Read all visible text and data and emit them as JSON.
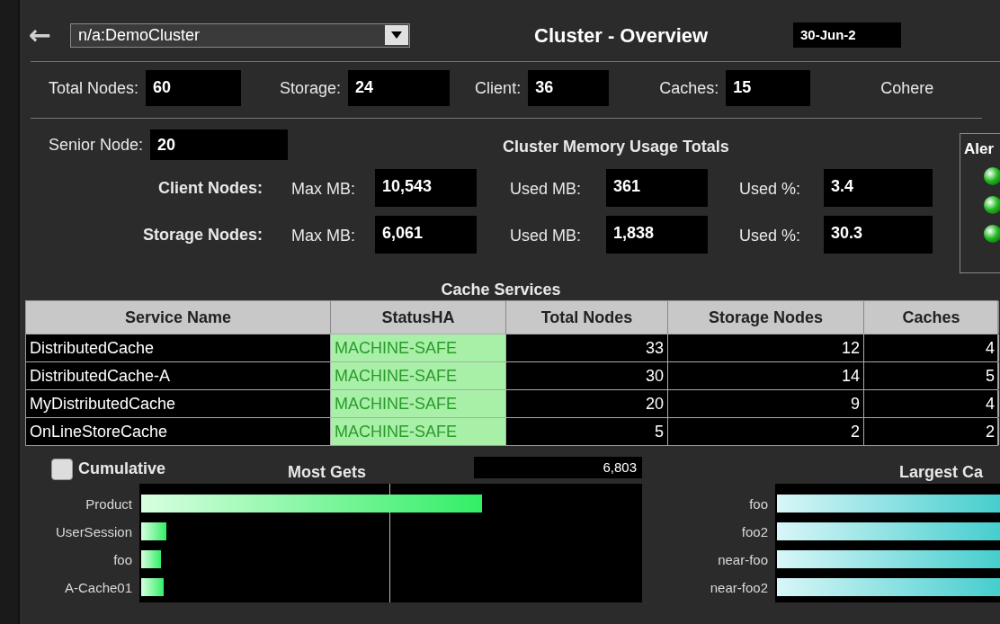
{
  "header": {
    "back": "←",
    "cluster_select": "n/a:DemoCluster",
    "title": "Cluster - Overview",
    "date": "30-Jun-2"
  },
  "counts": [
    {
      "label": "Total Nodes:",
      "value": "60"
    },
    {
      "label": "Storage:",
      "value": "24"
    },
    {
      "label": "Client:",
      "value": "36"
    },
    {
      "label": "Caches:",
      "value": "15"
    },
    {
      "label": "Cohere"
    }
  ],
  "senior_node": {
    "label": "Senior Node:",
    "value": "20"
  },
  "memory": {
    "title": "Cluster Memory Usage Totals",
    "rows": [
      {
        "label": "Client Nodes:",
        "fields": [
          {
            "label": "Max MB:",
            "value": "10,543"
          },
          {
            "label": "Used MB:",
            "value": "361"
          },
          {
            "label": "Used %:",
            "value": "3.4"
          }
        ]
      },
      {
        "label": "Storage Nodes:",
        "fields": [
          {
            "label": "Max MB:",
            "value": "6,061"
          },
          {
            "label": "Used MB:",
            "value": "1,838"
          },
          {
            "label": "Used %:",
            "value": "30.3"
          }
        ]
      }
    ]
  },
  "alerts": {
    "title": "Aler",
    "lights": [
      {
        "on": true
      },
      {
        "on": true
      },
      {
        "on": true
      }
    ]
  },
  "cache_services": {
    "title": "Cache Services",
    "columns": [
      {
        "label": "Service Name",
        "kind": "text"
      },
      {
        "label": "StatusHA",
        "kind": "status"
      },
      {
        "label": "Total Nodes",
        "kind": "number"
      },
      {
        "label": "Storage Nodes",
        "kind": "number"
      },
      {
        "label": "Caches",
        "kind": "number"
      }
    ],
    "rows": [
      [
        "DistributedCache",
        "MACHINE-SAFE",
        "33",
        "12",
        "4"
      ],
      [
        "DistributedCache-A",
        "MACHINE-SAFE",
        "30",
        "14",
        "5"
      ],
      [
        "MyDistributedCache",
        "MACHINE-SAFE",
        "20",
        "9",
        "4"
      ],
      [
        "OnLineStoreCache",
        "MACHINE-SAFE",
        "5",
        "2",
        "2"
      ]
    ]
  },
  "cumulative": {
    "label": "Cumulative",
    "checked": false
  },
  "most_gets": {
    "title": "Most Gets",
    "max_value": "6,803",
    "bars": [
      {
        "label": "Product",
        "level": 0.68
      },
      {
        "label": "UserSession",
        "level": 0.05
      },
      {
        "label": "foo",
        "level": 0.04
      },
      {
        "label": "A-Cache01",
        "level": 0.045
      }
    ]
  },
  "largest_caches": {
    "title": "Largest Ca",
    "bars": [
      {
        "label": "foo"
      },
      {
        "label": "foo2"
      },
      {
        "label": "near-foo"
      },
      {
        "label": "near-foo2"
      }
    ]
  }
}
